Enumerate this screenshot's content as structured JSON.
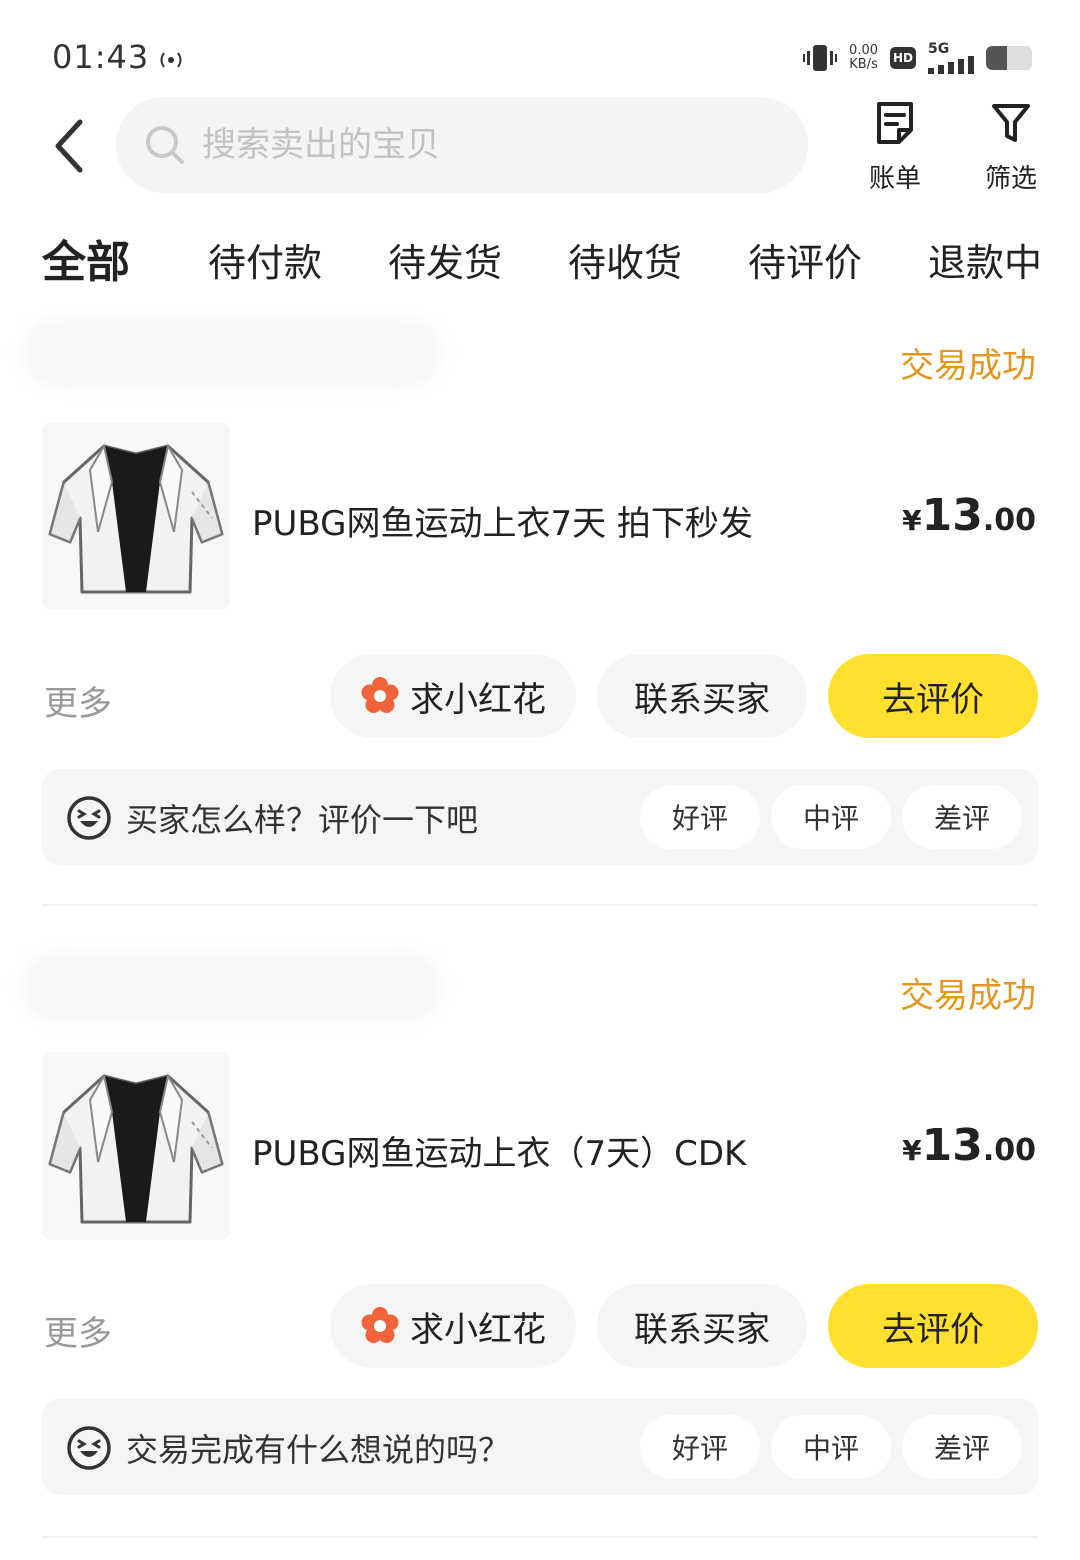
{
  "status_bar": {
    "time": "01:43",
    "net_speed_value": "0.00",
    "net_speed_unit": "KB/s",
    "hd": "HD",
    "network": "5G",
    "battery_level": 0.45
  },
  "header": {
    "search_placeholder": "搜索卖出的宝贝",
    "bill_label": "账单",
    "filter_label": "筛选"
  },
  "tabs": [
    {
      "label": "全部",
      "active": true
    },
    {
      "label": "待付款",
      "active": false
    },
    {
      "label": "待发货",
      "active": false
    },
    {
      "label": "待收货",
      "active": false
    },
    {
      "label": "待评价",
      "active": false
    },
    {
      "label": "退款中",
      "active": false
    }
  ],
  "orders": [
    {
      "status": "交易成功",
      "title": "PUBG网鱼运动上衣7天 拍下秒发",
      "price_symbol": "¥",
      "price_int": "13",
      "price_dec": ".00",
      "more_label": "更多",
      "flower_label": "求小红花",
      "contact_label": "联系买家",
      "review_label": "去评价",
      "review_prompt": "买家怎么样？评价一下吧",
      "chip_good": "好评",
      "chip_mid": "中评",
      "chip_bad": "差评"
    },
    {
      "status": "交易成功",
      "title": "PUBG网鱼运动上衣（7天）CDK",
      "price_symbol": "¥",
      "price_int": "13",
      "price_dec": ".00",
      "more_label": "更多",
      "flower_label": "求小红花",
      "contact_label": "联系买家",
      "review_label": "去评价",
      "review_prompt": "交易完成有什么想说的吗？",
      "chip_good": "好评",
      "chip_mid": "中评",
      "chip_bad": "差评"
    }
  ],
  "colors": {
    "accent_yellow": "#ffe02e",
    "status_orange": "#e3951e",
    "flower_red": "#f0643c"
  }
}
